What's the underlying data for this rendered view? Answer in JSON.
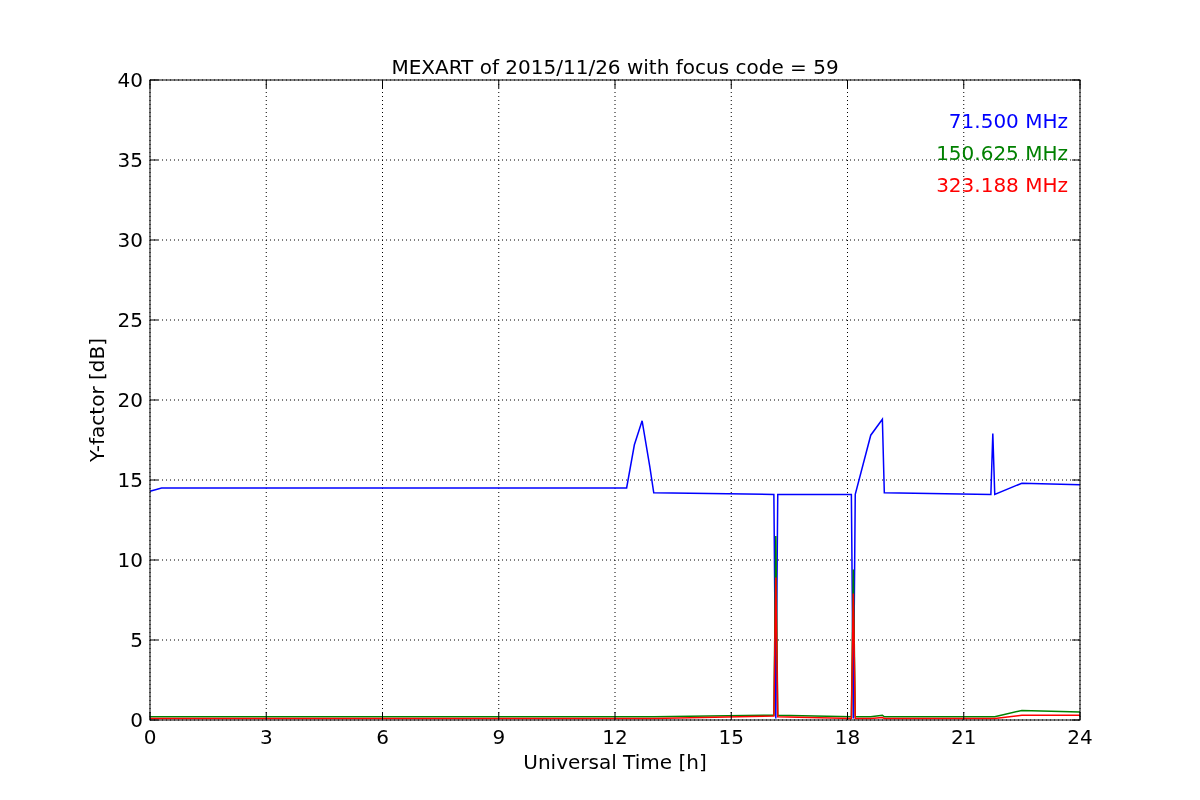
{
  "figure": {
    "chart_data": {
      "type": "line",
      "title": "MEXART of 2015/11/26 with focus code = 59",
      "xlabel": "Universal Time [h]",
      "ylabel": "Y-factor [dB]",
      "x": [
        0,
        0.3,
        12.3,
        12.5,
        12.7,
        12.9,
        13,
        16.1,
        16.15,
        16.2,
        18.1,
        18.15,
        18.2,
        18.6,
        18.9,
        18.95,
        21.7,
        21.75,
        21.8,
        22.5,
        24
      ],
      "series": [
        {
          "name": "71.500 MHz",
          "color": "#0000ff",
          "values": [
            14.3,
            14.5,
            14.5,
            17.2,
            18.7,
            15.8,
            14.2,
            14.1,
            0.1,
            14.1,
            14.1,
            0.1,
            14.1,
            17.8,
            18.8,
            14.2,
            14.1,
            17.9,
            14.1,
            14.8,
            14.7
          ]
        },
        {
          "name": "150.625 MHz",
          "color": "#008000",
          "values": [
            0.2,
            0.2,
            0.2,
            0.2,
            0.2,
            0.2,
            0.2,
            0.3,
            11.5,
            0.3,
            0.2,
            9.4,
            0.2,
            0.2,
            0.3,
            0.2,
            0.2,
            0.2,
            0.2,
            0.6,
            0.5
          ]
        },
        {
          "name": "323.188 MHz",
          "color": "#ff0000",
          "values": [
            0.1,
            0.1,
            0.1,
            0.1,
            0.1,
            0.1,
            0.1,
            0.25,
            8.9,
            0.2,
            0.1,
            7.9,
            0.1,
            0.1,
            0.15,
            0.1,
            0.1,
            0.1,
            0.1,
            0.3,
            0.3
          ]
        }
      ],
      "xlim": [
        0,
        24
      ],
      "ylim": [
        0,
        40
      ],
      "xticks": [
        0,
        3,
        6,
        9,
        12,
        15,
        18,
        21,
        24
      ],
      "yticks": [
        0,
        5,
        10,
        15,
        20,
        25,
        30,
        35,
        40
      ],
      "grid": true
    }
  }
}
